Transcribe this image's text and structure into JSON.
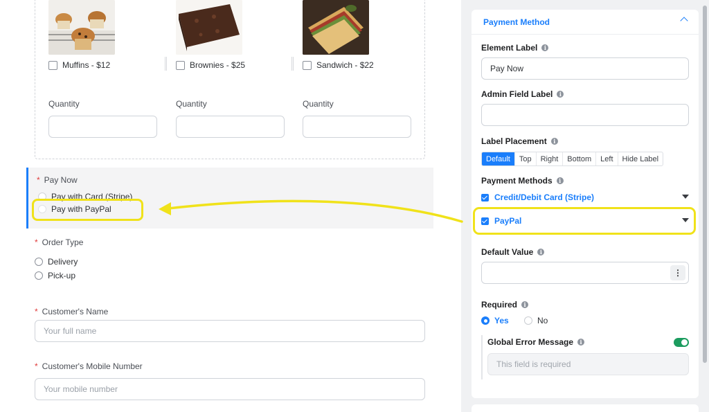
{
  "products": [
    {
      "label": "Muffins - $12",
      "qty_label": "Quantity",
      "image": "muffin-image"
    },
    {
      "label": "Brownies - $25",
      "qty_label": "Quantity",
      "image": "brownie-image"
    },
    {
      "label": "Sandwich - $22",
      "qty_label": "Quantity",
      "image": "sandwich-image"
    }
  ],
  "pay_now": {
    "label": "Pay Now",
    "options": [
      "Pay with Card (Stripe)",
      "Pay with PayPal"
    ]
  },
  "order_type": {
    "label": "Order Type",
    "options": [
      "Delivery",
      "Pick-up"
    ]
  },
  "customer_name": {
    "label": "Customer's Name",
    "placeholder": "Your full name"
  },
  "customer_mobile": {
    "label": "Customer's Mobile Number",
    "placeholder": "Your mobile number"
  },
  "panel": {
    "title": "Payment Method",
    "element_label": {
      "label": "Element Label",
      "value": "Pay Now"
    },
    "admin_field_label": {
      "label": "Admin Field Label",
      "value": ""
    },
    "label_placement": {
      "label": "Label Placement",
      "options": [
        "Default",
        "Top",
        "Right",
        "Bottom",
        "Left",
        "Hide Label"
      ],
      "selected": "Default"
    },
    "payment_methods": {
      "label": "Payment Methods",
      "items": [
        "Credit/Debit Card (Stripe)",
        "PayPal"
      ]
    },
    "default_value": {
      "label": "Default Value",
      "value": ""
    },
    "required": {
      "label": "Required",
      "yes": "Yes",
      "no": "No",
      "selected": "Yes"
    },
    "global_error": {
      "label": "Global Error Message",
      "placeholder": "This field is required",
      "enabled": true
    }
  },
  "colors": {
    "accent": "#1a7efb",
    "highlight": "#f0e21a",
    "toggle_on": "#1c9c5f",
    "required": "#e03c3c"
  }
}
